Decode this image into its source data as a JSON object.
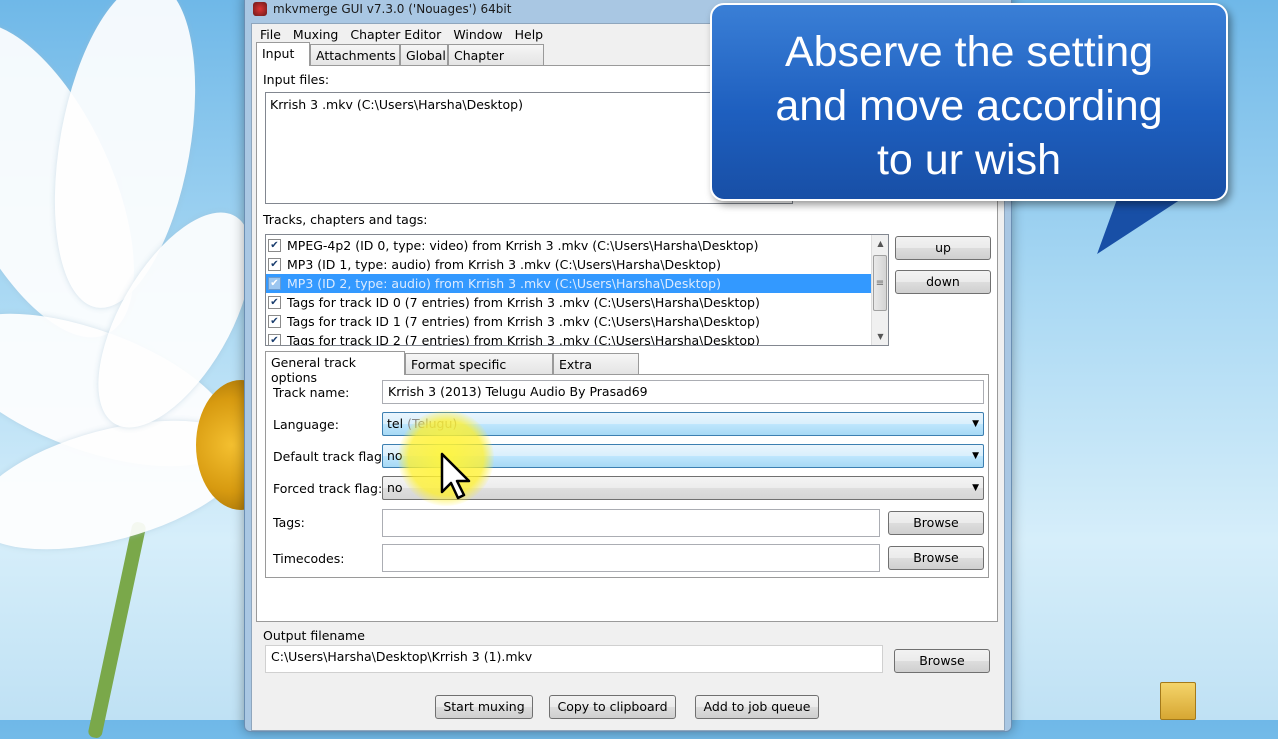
{
  "window": {
    "title": "mkvmerge GUI v7.3.0 ('Nouages') 64bit"
  },
  "menu": [
    "File",
    "Muxing",
    "Chapter Editor",
    "Window",
    "Help"
  ],
  "main_tabs": [
    "Input",
    "Attachments",
    "Global",
    "Chapter Editor"
  ],
  "input_files": {
    "label": "Input files:",
    "items": [
      "Krrish 3 .mkv (C:\\Users\\Harsha\\Desktop)"
    ]
  },
  "tracks": {
    "label": "Tracks, chapters and tags:",
    "items": [
      {
        "text": "MPEG-4p2 (ID 0, type: video) from Krrish 3 .mkv (C:\\Users\\Harsha\\Desktop)",
        "checked": true,
        "selected": false
      },
      {
        "text": "MP3 (ID 1, type: audio) from Krrish 3 .mkv (C:\\Users\\Harsha\\Desktop)",
        "checked": true,
        "selected": false
      },
      {
        "text": "MP3 (ID 2, type: audio) from Krrish 3 .mkv (C:\\Users\\Harsha\\Desktop)",
        "checked": true,
        "selected": true
      },
      {
        "text": "Tags for track ID 0 (7 entries) from Krrish 3 .mkv (C:\\Users\\Harsha\\Desktop)",
        "checked": true,
        "selected": false
      },
      {
        "text": "Tags for track ID 1 (7 entries) from Krrish 3 .mkv (C:\\Users\\Harsha\\Desktop)",
        "checked": true,
        "selected": false
      },
      {
        "text": "Tags for track ID 2 (7 entries) from Krrish 3 .mkv (C:\\Users\\Harsha\\Desktop)",
        "checked": true,
        "selected": false
      }
    ],
    "up_label": "up",
    "down_label": "down"
  },
  "track_tabs": [
    "General track options",
    "Format specific options",
    "Extra options"
  ],
  "general": {
    "track_name_label": "Track name:",
    "track_name_value": "Krrish 3 (2013) Telugu Audio By Prasad69",
    "language_label": "Language:",
    "language_code": "tel",
    "language_name": "(Telugu)",
    "default_flag_label": "Default track flag:",
    "default_flag_value": "no",
    "forced_flag_label": "Forced track flag:",
    "forced_flag_value": "no",
    "tags_label": "Tags:",
    "tags_value": "",
    "timecodes_label": "Timecodes:",
    "timecodes_value": "",
    "browse_label": "Browse"
  },
  "output": {
    "label": "Output filename",
    "value": "C:\\Users\\Harsha\\Desktop\\Krrish 3  (1).mkv",
    "browse_label": "Browse"
  },
  "actions": {
    "start": "Start muxing",
    "copy": "Copy to clipboard",
    "queue": "Add to job queue"
  },
  "callout": {
    "lines": [
      "Abserve the setting",
      "and move according",
      "to ur wish"
    ]
  },
  "colors": {
    "selection": "#3399ff",
    "callout": "#1e5fbf",
    "cursor_halo": "#fff03c"
  }
}
